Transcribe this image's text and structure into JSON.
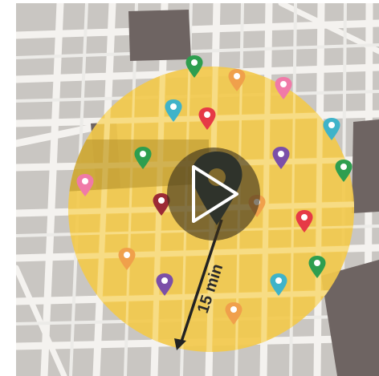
{
  "map": {
    "radius_label": "15 min",
    "colors": {
      "land": "#c9c6c2",
      "street": "#f4f2ef",
      "building": "#6e6462",
      "coverage": "#f2c94c",
      "coverage_street": "#f7dc84",
      "radius_arrow": "#222222",
      "center_pin": "#1e3c47"
    },
    "markers": [
      {
        "color": "green",
        "hex": "#2e9e4f",
        "icon": "map-marker-icon"
      },
      {
        "color": "orange",
        "hex": "#f0a04b",
        "icon": "map-marker-icon"
      },
      {
        "color": "pink",
        "hex": "#f07aa8",
        "icon": "map-marker-icon"
      },
      {
        "color": "blue",
        "hex": "#3fb3c9",
        "icon": "map-marker-icon"
      },
      {
        "color": "red",
        "hex": "#e63946",
        "icon": "map-marker-icon"
      },
      {
        "color": "purple",
        "hex": "#7b4fa8",
        "icon": "map-marker-icon"
      },
      {
        "color": "maroon",
        "hex": "#9c2a35",
        "icon": "map-marker-icon"
      }
    ]
  },
  "video": {
    "play_icon": "play-icon"
  }
}
